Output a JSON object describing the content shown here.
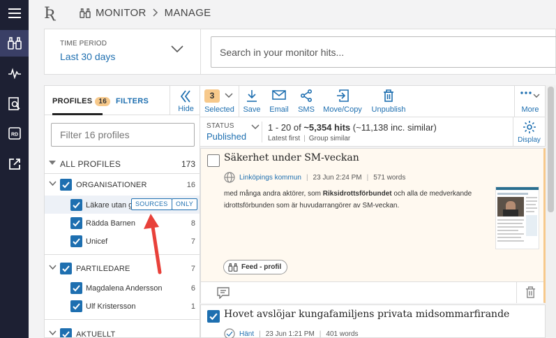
{
  "breadcrumb": {
    "logo": "Ʀ",
    "section": "MONITOR",
    "page": "MANAGE"
  },
  "time_period": {
    "label": "TIME PERIOD",
    "value": "Last 30 days"
  },
  "search": {
    "placeholder": "Search in your monitor hits..."
  },
  "profiles_panel": {
    "tab_profiles": "PROFILES",
    "profiles_count": "16",
    "tab_filters": "FILTERS",
    "hide_label": "Hide",
    "filter_placeholder": "Filter 16 profiles",
    "all_profiles_label": "ALL PROFILES",
    "all_profiles_count": "173",
    "groups": [
      {
        "label": "ORGANISATIONER",
        "count": "16",
        "items": [
          {
            "label": "Läkare utan g",
            "sources_label": "SOURCES",
            "only_label": "ONLY"
          },
          {
            "label": "Rädda Barnen",
            "count": "8"
          },
          {
            "label": "Unicef",
            "count": "7"
          }
        ]
      },
      {
        "label": "PARTILEDARE",
        "count": "7",
        "items": [
          {
            "label": "Magdalena Andersson",
            "count": "6"
          },
          {
            "label": "Ulf Kristersson",
            "count": "1"
          }
        ]
      },
      {
        "label": "AKTUELLT"
      }
    ]
  },
  "toolbar": {
    "selected_count": "3",
    "selected_label": "Selected",
    "save": "Save",
    "email": "Email",
    "sms": "SMS",
    "move_copy": "Move/Copy",
    "unpublish": "Unpublish",
    "more": "More"
  },
  "status": {
    "label": "STATUS",
    "value": "Published",
    "hits_prefix": "1 - 20 of ",
    "hits_total": "~5,354 hits",
    "hits_suffix": " (~11,138 inc. similar)",
    "sort": "Latest first",
    "group": "Group similar",
    "display": "Display"
  },
  "results": [
    {
      "title": "Säkerhet under SM-veckan",
      "source": "Linköpings kommun",
      "date": "23 Jun 2:24 PM",
      "words": "571 words",
      "snippet_pre": "med många andra aktörer, som ",
      "snippet_bold": "Riksidrottsförbundet",
      "snippet_post": " och alla de medverkande idrottsförbunden som är huvudarrangörer av SM-veckan.",
      "feed": "Feed - profil"
    },
    {
      "title": "Hovet avslöjar kungafamiljens privata midsommarfirande",
      "source": "Hänt",
      "date": "23 Jun 1:21 PM",
      "words": "401 words"
    }
  ],
  "colors": {
    "nav_bg": "#1d2033",
    "accent": "#1e6fb0",
    "badge": "#f7c98b",
    "highlight": "#f7c98b",
    "arrow": "#e8413a"
  }
}
